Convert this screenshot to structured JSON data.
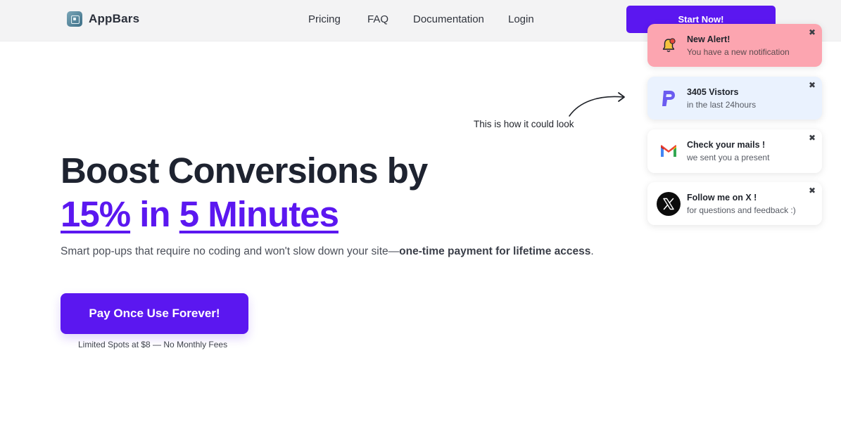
{
  "header": {
    "brand": "AppBars",
    "nav": [
      "Pricing",
      "FAQ",
      "Documentation",
      "Login"
    ],
    "start_label": "Start Now!"
  },
  "hero": {
    "line1": "Boost Conversions by",
    "percent": "15%",
    "in_word": " in ",
    "minutes": "5 Minutes",
    "sub_text": "Smart pop-ups that require no coding and won't slow down your site—",
    "sub_bold": "one-time payment for lifetime access",
    "sub_end": ".",
    "cta_label": "Pay Once Use Forever!",
    "cta_note": "Limited Spots at $8 — No Monthly Fees"
  },
  "hint": {
    "text": "This is how it could look"
  },
  "notifications": [
    {
      "title": "New Alert!",
      "subtitle": "You have a new notification",
      "icon": "bell-icon",
      "close": "✖"
    },
    {
      "title": "3405 Vistors",
      "subtitle": "in the last 24hours",
      "icon": "p-brand-icon",
      "close": "✖"
    },
    {
      "title": "Check your mails !",
      "subtitle": "we sent you a present",
      "icon": "gmail-icon",
      "close": "✖"
    },
    {
      "title": "Follow me on X !",
      "subtitle": "for questions and feedback :)",
      "icon": "x-logo-icon",
      "close": "✖"
    }
  ],
  "colors": {
    "accent": "#5b17f0",
    "alert_bg": "#fca5b0",
    "visitors_bg": "#eaf2fe"
  }
}
